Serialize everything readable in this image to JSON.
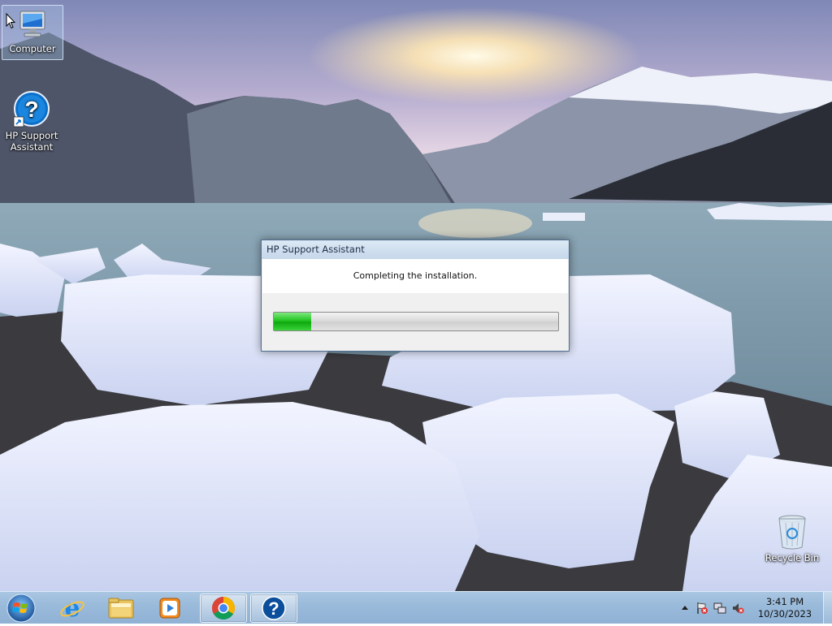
{
  "desktop": {
    "icons": [
      {
        "label": "Computer",
        "icon": "computer-icon"
      },
      {
        "label_line1": "HP Support",
        "label_line2": "Assistant",
        "icon": "hp-support-assistant-icon"
      },
      {
        "label": "Recycle Bin",
        "icon": "recycle-bin-icon"
      }
    ]
  },
  "dialog": {
    "title": "HP Support Assistant",
    "message": "Completing the installation.",
    "progress_fraction": 0.13,
    "progress_color": "#1fbf1f"
  },
  "taskbar": {
    "items": [
      {
        "name": "start-button",
        "icon": "windows-logo-icon"
      },
      {
        "name": "internet-explorer",
        "icon": "internet-explorer-icon"
      },
      {
        "name": "windows-explorer",
        "icon": "folder-icon"
      },
      {
        "name": "media-player",
        "icon": "media-player-icon"
      },
      {
        "name": "google-chrome",
        "icon": "chrome-icon",
        "active": true
      },
      {
        "name": "hp-support-assistant",
        "icon": "hp-support-assistant-icon",
        "active": true
      }
    ],
    "tray": {
      "icons": [
        "show-hidden-icons-chevron-icon",
        "action-center-flag-icon",
        "network-icon",
        "volume-muted-icon"
      ],
      "time": "3:41 PM",
      "date": "10/30/2023"
    }
  }
}
